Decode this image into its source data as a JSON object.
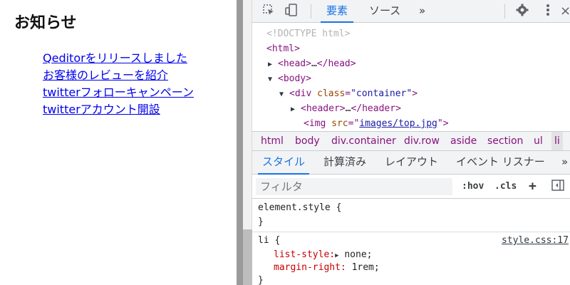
{
  "page": {
    "title": "お知らせ",
    "news": [
      "Qeditorをリリースしました",
      "お客様のレビューを紹介",
      "twitterフォローキャンペーン",
      "twitterアカウント開設"
    ]
  },
  "devtools": {
    "tabs": [
      "要素",
      "ソース"
    ],
    "more_tabs": "»",
    "dom": {
      "doctype": "<!DOCTYPE html>",
      "html": "<html>",
      "head_open": "<head>",
      "head_ellipsis": "…",
      "head_close": "</head>",
      "body_open": "<body>",
      "div_open": "<div ",
      "div_attr_name": "class",
      "div_attr_val": "\"container\"",
      "div_close_bracket": ">",
      "header_open": "<header>",
      "header_ellipsis": "…",
      "header_close": "</header>",
      "img_open": "<img ",
      "img_attr_name": "src",
      "img_attr_val": "images/top.jpg",
      "img_close": ">"
    },
    "breadcrumbs": [
      "html",
      "body",
      "div.container",
      "div.row",
      "aside",
      "section",
      "ul",
      "li"
    ],
    "sub_tabs": [
      "スタイル",
      "計算済み",
      "レイアウト",
      "イベント リスナー"
    ],
    "sub_more": "»",
    "filter_placeholder": "フィルタ",
    "filter_hov": ":hov",
    "filter_cls": ".cls",
    "filter_plus": "+",
    "styles": {
      "element_style": "element.style",
      "open_brace": "{",
      "close_brace": "}",
      "li_selector": "li",
      "li_source": "style.css:17",
      "prop1_name": "list-style:",
      "prop1_val": "none;",
      "prop2_name": "margin-right:",
      "prop2_val": "1rem;"
    }
  }
}
